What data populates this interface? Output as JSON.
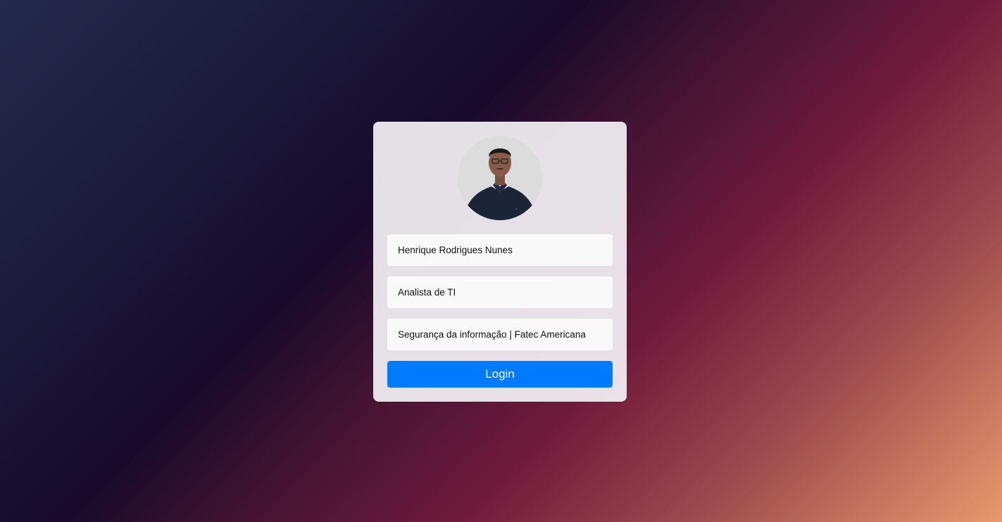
{
  "profile": {
    "name": "Henrique Rodrigues Nunes",
    "role": "Analista de TI",
    "education": "Segurança da informação | Fatec Americana"
  },
  "actions": {
    "login_label": "Login"
  },
  "colors": {
    "accent": "#007bff",
    "card_background": "#efedf1",
    "field_background": "#faf9fa"
  }
}
